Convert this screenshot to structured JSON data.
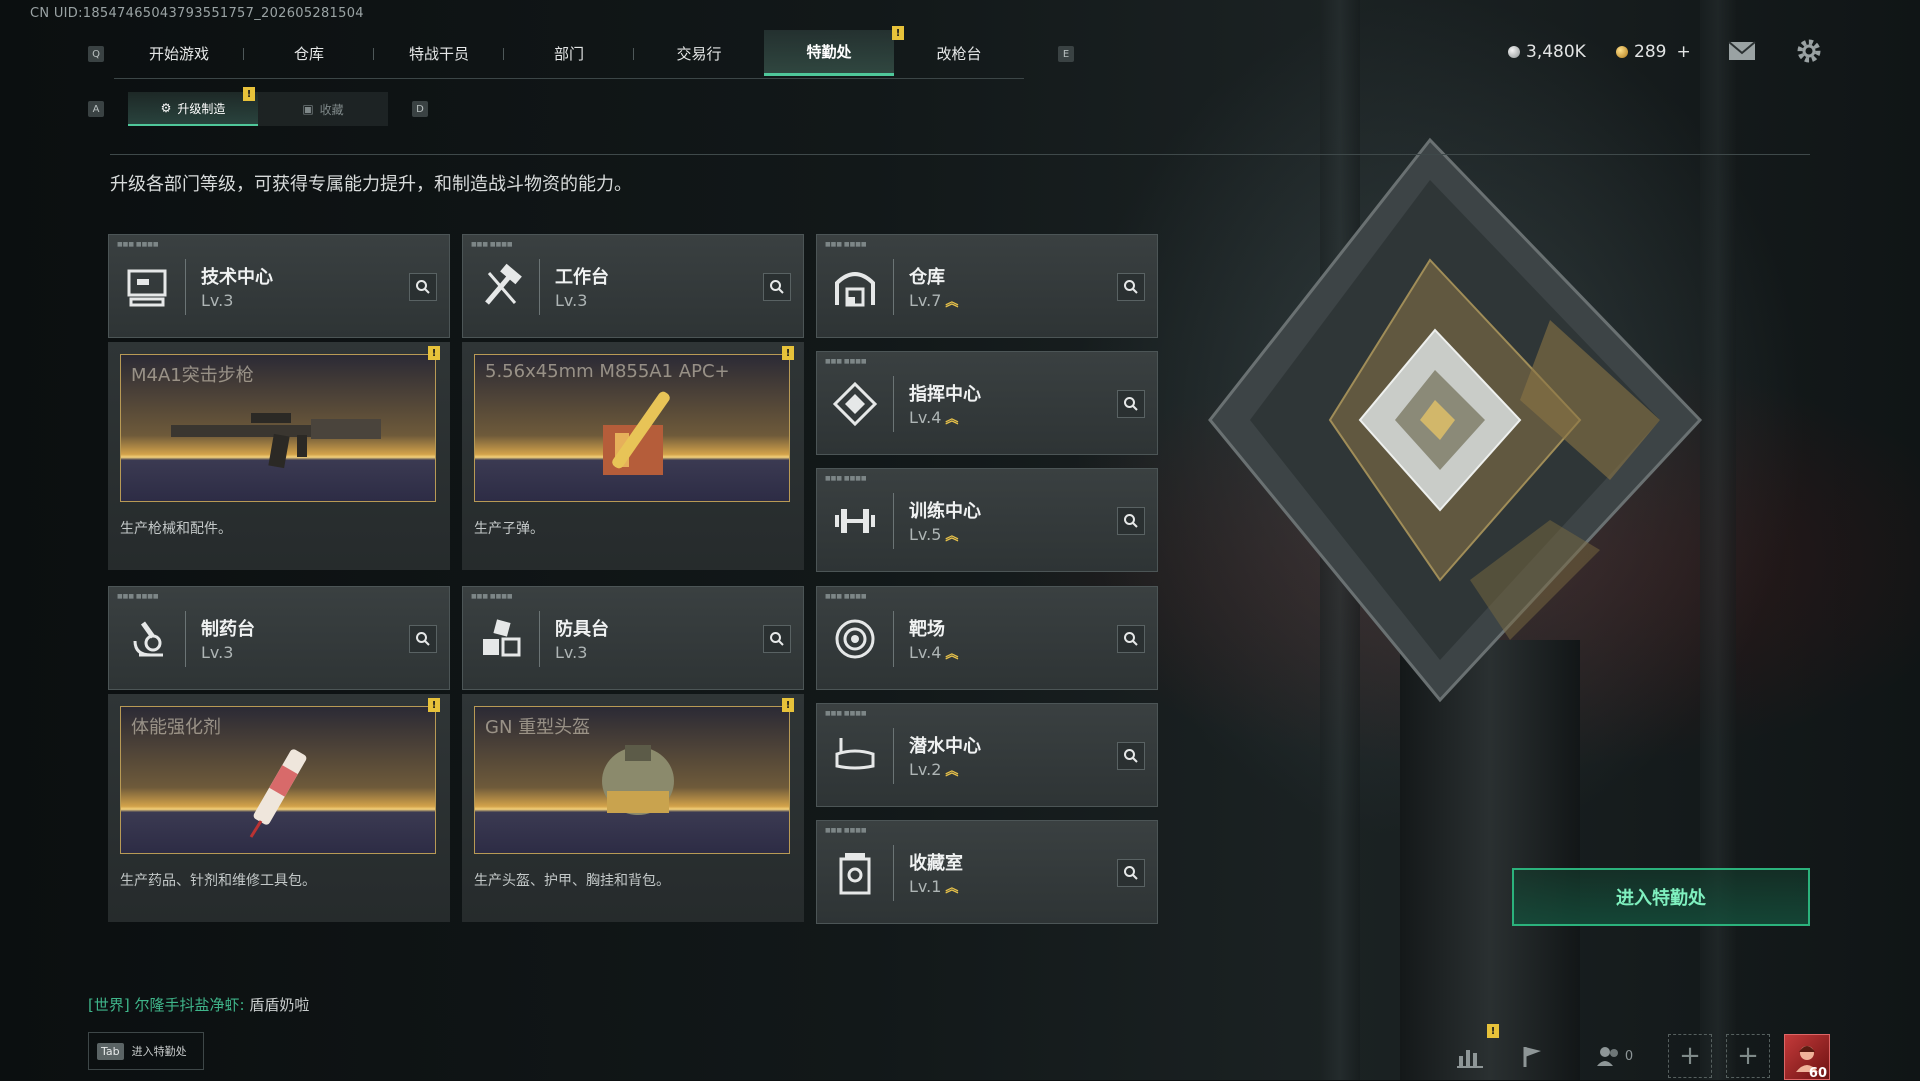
{
  "uid": "CN UID:18547465043793551757_202605281504",
  "nav": {
    "left_key": "Q",
    "right_key": "E",
    "tabs": [
      "开始游戏",
      "仓库",
      "特战干员",
      "部门",
      "交易行",
      "特勤处",
      "改枪台"
    ],
    "active_tab": "特勤处"
  },
  "currency": {
    "silver": "3,480K",
    "gold": "289",
    "plus": "+"
  },
  "subtabs": {
    "left_key": "A",
    "right_key": "D",
    "items": [
      "升级制造",
      "收藏"
    ],
    "active": "升级制造"
  },
  "description": "升级各部门等级，可获得专属能力提升，和制造战斗物资的能力。",
  "departments": [
    {
      "name": "技术中心",
      "level": "Lv.3",
      "upgrade": false,
      "icon": "computer-icon"
    },
    {
      "name": "工作台",
      "level": "Lv.3",
      "upgrade": false,
      "icon": "tools-icon"
    },
    {
      "name": "仓库",
      "level": "Lv.7",
      "upgrade": true,
      "icon": "warehouse-icon"
    },
    {
      "name": "指挥中心",
      "level": "Lv.4",
      "upgrade": true,
      "icon": "command-icon"
    },
    {
      "name": "训练中心",
      "level": "Lv.5",
      "upgrade": true,
      "icon": "dumbbell-icon"
    },
    {
      "name": "制药台",
      "level": "Lv.3",
      "upgrade": false,
      "icon": "microscope-icon"
    },
    {
      "name": "防具台",
      "level": "Lv.3",
      "upgrade": false,
      "icon": "armor-boxes-icon"
    },
    {
      "name": "靶场",
      "level": "Lv.4",
      "upgrade": true,
      "icon": "target-icon"
    },
    {
      "name": "潜水中心",
      "level": "Lv.2",
      "upgrade": true,
      "icon": "diving-mask-icon"
    },
    {
      "name": "收藏室",
      "level": "Lv.1",
      "upgrade": true,
      "icon": "collection-icon"
    }
  ],
  "productions": [
    {
      "title": "M4A1突击步枪",
      "desc": "生产枪械和配件。",
      "item": "rifle"
    },
    {
      "title": "5.56x45mm M855A1 APC+",
      "desc": "生产子弹。",
      "item": "ammo"
    },
    {
      "title": "体能强化剂",
      "desc": "生产药品、针剂和维修工具包。",
      "item": "syringe"
    },
    {
      "title": "GN 重型头盔",
      "desc": "生产头盔、护甲、胸挂和背包。",
      "item": "helmet"
    }
  ],
  "badge_text": "!",
  "chat": {
    "channel": "[世界]",
    "user": "尔隆手抖盐净虾:",
    "message": "盾盾奶啦"
  },
  "tab_hint": {
    "key": "Tab",
    "label": "进入特勤处"
  },
  "enter_button": "进入特勤处",
  "friends_count": "0",
  "player_level": "60",
  "colors": {
    "accent": "#4fc79a",
    "upgrade": "#e8c24a",
    "badge": "#e7c23a"
  }
}
